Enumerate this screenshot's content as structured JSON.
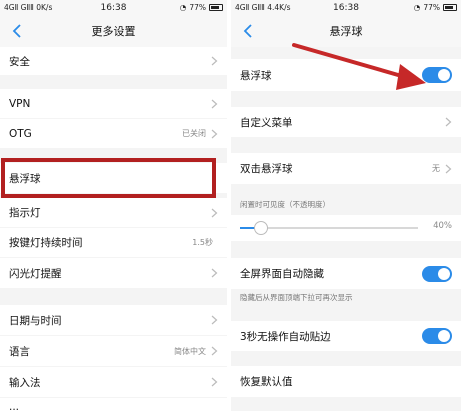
{
  "left": {
    "status": {
      "carrier": "4GⅡ GⅡⅡ 0K/s",
      "time": "16:38",
      "battery": "77%"
    },
    "title": "更多设置",
    "rows": [
      {
        "label": "安全",
        "value": ""
      },
      {
        "label": "VPN",
        "value": ""
      },
      {
        "label": "OTG",
        "value": "已关闭"
      },
      {
        "label": "悬浮球",
        "value": ""
      },
      {
        "label": "指示灯",
        "value": ""
      },
      {
        "label": "按键灯持续时间",
        "value": "1.5秒"
      },
      {
        "label": "闪光灯提醒",
        "value": ""
      },
      {
        "label": "日期与时间",
        "value": ""
      },
      {
        "label": "语言",
        "value": "简体中文"
      },
      {
        "label": "输入法",
        "value": ""
      },
      {
        "label": "...",
        "value": ""
      }
    ]
  },
  "right": {
    "status": {
      "carrier": "4GⅡ GⅡⅡ 4.4K/s",
      "time": "16:38",
      "battery": "77%"
    },
    "title": "悬浮球",
    "floating_ball": {
      "label": "悬浮球",
      "on": true
    },
    "custom_menu": {
      "label": "自定义菜单"
    },
    "double_click": {
      "label": "双击悬浮球",
      "value": "无"
    },
    "opacity": {
      "label": "闲置时可见度（不透明度）",
      "value_text": "40%",
      "value": 0.4
    },
    "fullscreen_hide": {
      "label": "全屏界面自动隐藏",
      "on": true
    },
    "fullscreen_hint": "隐藏后从界面顶端下拉可再次显示",
    "auto_edge": {
      "label": "3秒无操作自动贴边",
      "on": true
    },
    "restore_default": {
      "label": "恢复默认值"
    }
  },
  "colors": {
    "accent": "#2b8be8",
    "highlight": "#b22020",
    "arrow": "#c62828"
  }
}
